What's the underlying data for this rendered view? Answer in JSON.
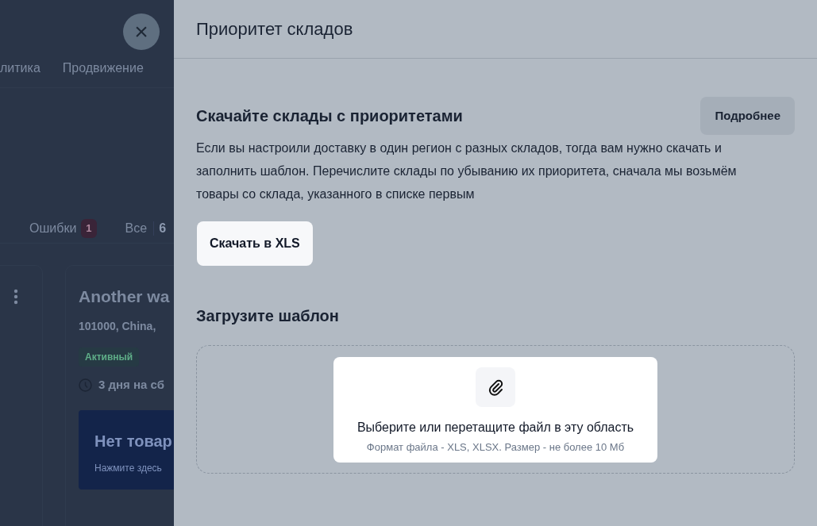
{
  "background_page": {
    "nav_items": [
      "литика",
      "Продвижение"
    ],
    "tabs": [
      {
        "label": "Ошибки",
        "count": "1"
      },
      {
        "label": "Все",
        "count": "6"
      }
    ],
    "card": {
      "title": "Another wa",
      "address": "101000, China,",
      "status": "Активный",
      "assembly_time": "3 дня на сб",
      "banner_title": "Нет товар",
      "banner_text": "Нажмите здесь"
    }
  },
  "close_button": "×",
  "panel": {
    "title": "Приоритет складов",
    "download_section": {
      "heading": "Скачайте склады с приоритетами",
      "more_button": "Подробнее",
      "description": "Если вы настроили доставку в один регион с разных складов, тогда вам нужно скачать и заполнить шаблон. Перечислите склады по убыванию их приоритета, сначала мы возьмём товары со склада, указанного в списке первым",
      "download_button": "Скачать в XLS"
    },
    "upload_section": {
      "heading": "Загрузите шаблон",
      "dropzone_text": "Выберите или перетащите файл в эту область",
      "dropzone_hint": "Формат файла - XLS, XLSX. Размер - не более 10 Мб"
    }
  }
}
